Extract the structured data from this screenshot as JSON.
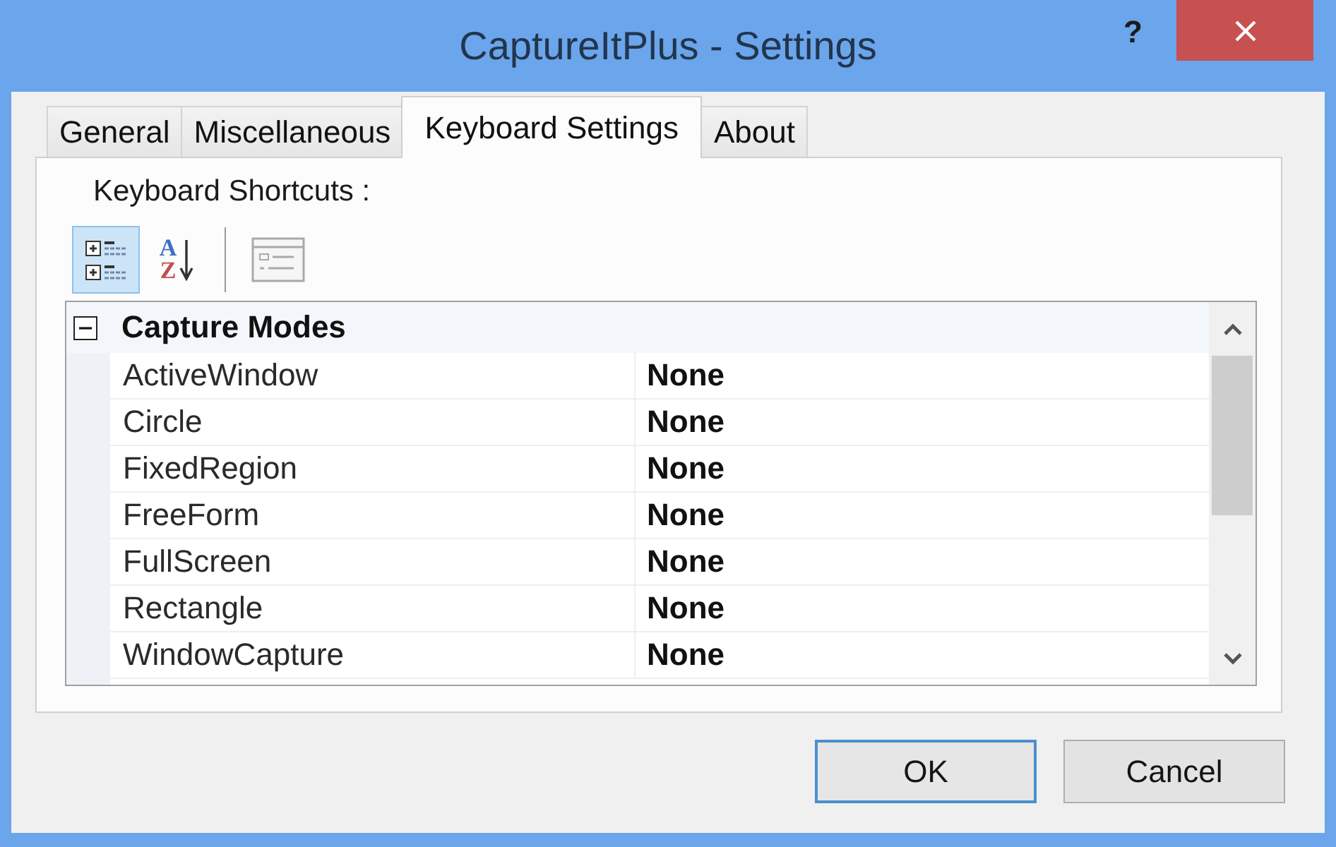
{
  "window": {
    "title": "CaptureItPlus - Settings",
    "help_button": "?"
  },
  "tabs": [
    {
      "label": "General",
      "selected": false
    },
    {
      "label": "Miscellaneous",
      "selected": false
    },
    {
      "label": "Keyboard Settings",
      "selected": true
    },
    {
      "label": "About",
      "selected": false
    }
  ],
  "tab_page": {
    "section_label": "Keyboard Shortcuts :",
    "toolbar": [
      {
        "kind": "categorized",
        "selected": true,
        "disabled": false
      },
      {
        "kind": "alphabetical",
        "top_letter": "A",
        "bottom_letter": "Z",
        "selected": false,
        "disabled": false
      },
      {
        "kind": "separator"
      },
      {
        "kind": "property_pages",
        "selected": false,
        "disabled": true
      }
    ],
    "property_grid": {
      "categories": [
        {
          "name": "Capture Modes",
          "expanded": true,
          "children": [
            {
              "name": "ActiveWindow",
              "value": "None",
              "modified": true
            },
            {
              "name": "Circle",
              "value": "None",
              "modified": true
            },
            {
              "name": "FixedRegion",
              "value": "None",
              "modified": true
            },
            {
              "name": "FreeForm",
              "value": "None",
              "modified": true
            },
            {
              "name": "FullScreen",
              "value": "None",
              "modified": true
            },
            {
              "name": "Rectangle",
              "value": "None",
              "modified": true
            },
            {
              "name": "WindowCapture",
              "value": "None",
              "modified": true
            }
          ]
        }
      ]
    }
  },
  "buttons": [
    {
      "label": "OK",
      "default": true
    },
    {
      "label": "Cancel",
      "default": false
    }
  ]
}
